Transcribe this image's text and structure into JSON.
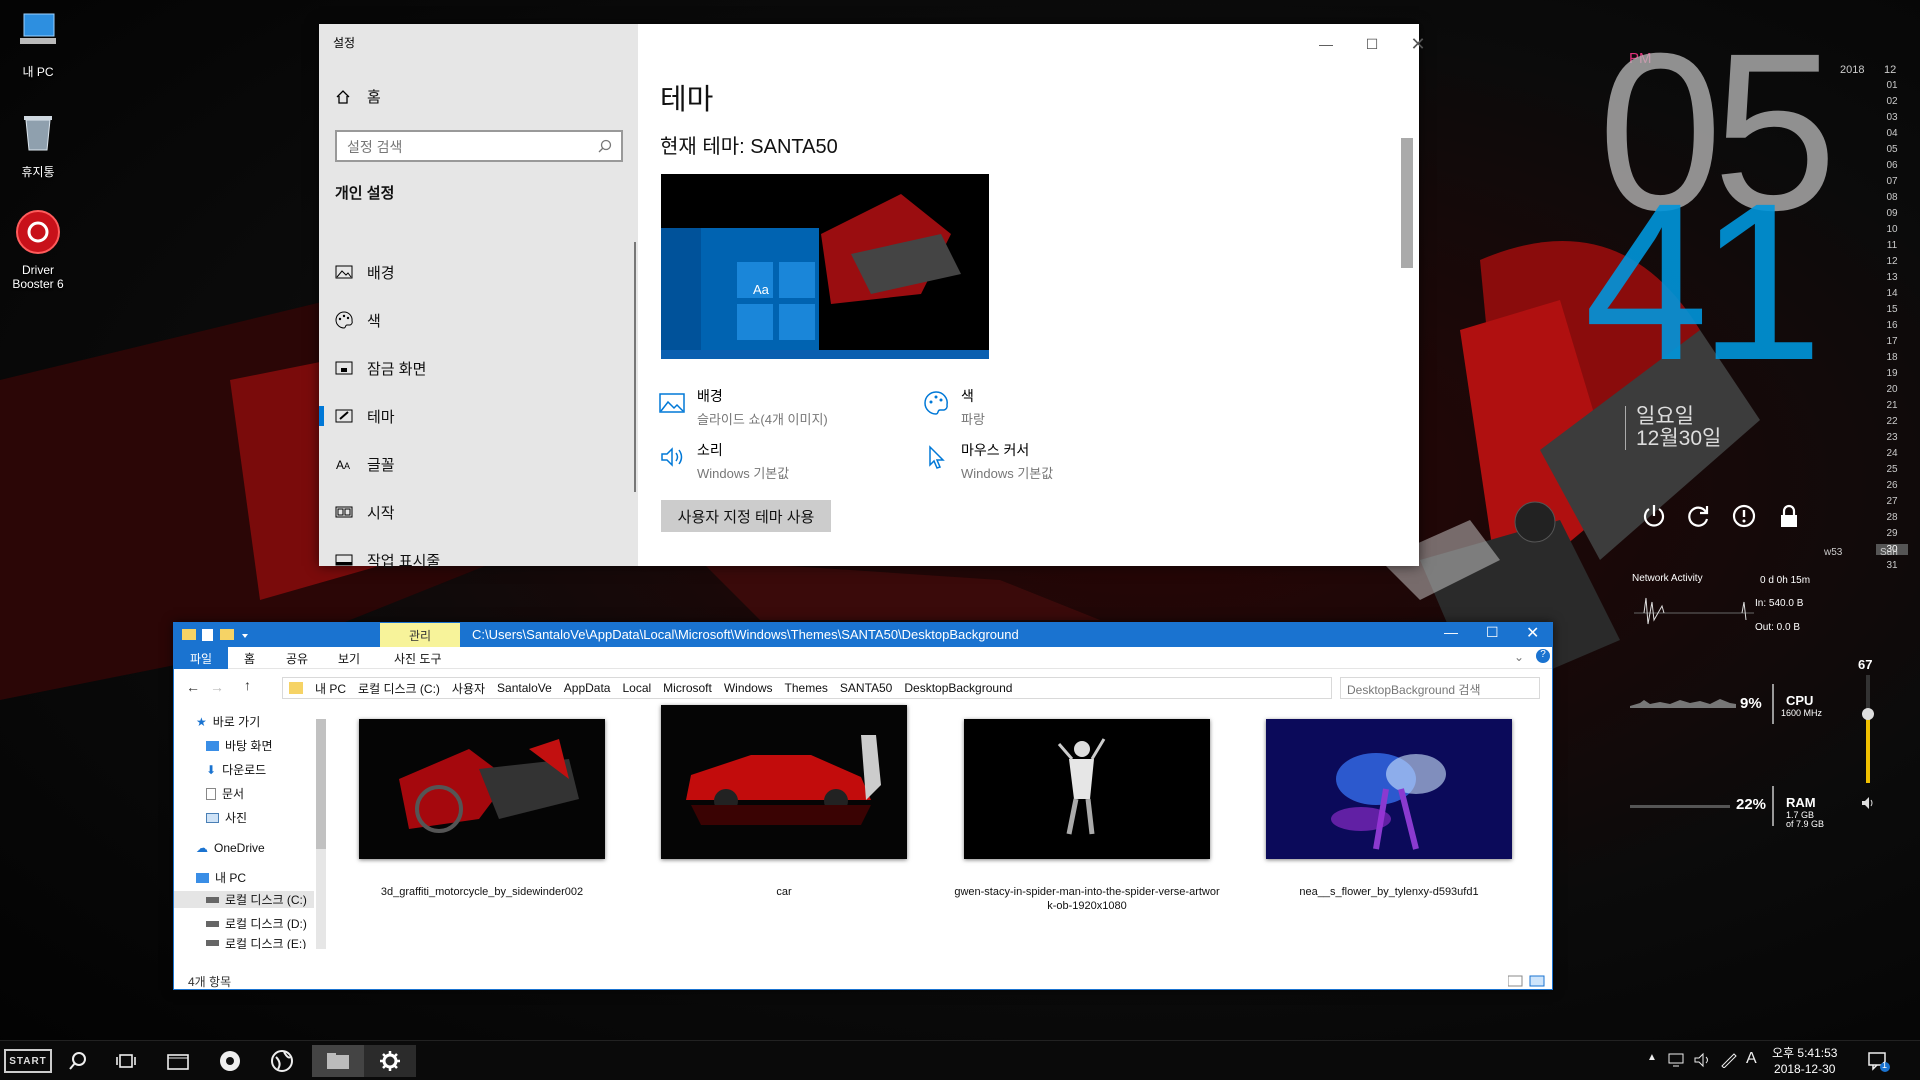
{
  "desktop": {
    "icons": [
      {
        "label": "내 PC",
        "icon": "computer-icon"
      },
      {
        "label": "휴지통",
        "icon": "recycle-bin-icon"
      },
      {
        "label": "Driver Booster 6",
        "icon": "driver-booster-icon"
      }
    ]
  },
  "settings": {
    "title": "설정",
    "home": "홈",
    "search_placeholder": "설정 검색",
    "section": "개인 설정",
    "nav": [
      {
        "label": "배경",
        "icon": "picture-icon"
      },
      {
        "label": "색",
        "icon": "palette-icon"
      },
      {
        "label": "잠금 화면",
        "icon": "lock-screen-icon"
      },
      {
        "label": "테마",
        "icon": "theme-icon",
        "active": true
      },
      {
        "label": "글꼴",
        "icon": "font-icon"
      },
      {
        "label": "시작",
        "icon": "start-icon"
      },
      {
        "label": "작업 표시줄",
        "icon": "taskbar-icon"
      }
    ],
    "heading": "테마",
    "current_theme": "현재 테마: SANTA50",
    "preview_sample": "Aa",
    "items": [
      {
        "title": "배경",
        "sub": "슬라이드 쇼(4개 이미지)",
        "icon": "picture-icon"
      },
      {
        "title": "색",
        "sub": "파랑",
        "icon": "palette-icon"
      },
      {
        "title": "소리",
        "sub": "Windows 기본값",
        "icon": "speaker-icon"
      },
      {
        "title": "마우스 커서",
        "sub": "Windows 기본값",
        "icon": "cursor-icon"
      }
    ],
    "custom_button": "사용자 지정 테마 사용"
  },
  "clock": {
    "ampm": "PM",
    "hour": "05",
    "minute": "41",
    "weekday": "일요일",
    "date": "12월30일"
  },
  "calendar": {
    "year": "2018",
    "month": "12",
    "days": [
      "01",
      "02",
      "03",
      "04",
      "05",
      "06",
      "07",
      "08",
      "09",
      "10",
      "11",
      "12",
      "13",
      "14",
      "15",
      "16",
      "17",
      "18",
      "19",
      "20",
      "21",
      "22",
      "23",
      "24",
      "25",
      "26",
      "27",
      "28",
      "29",
      "30",
      "31"
    ],
    "week": "w53",
    "current_day": "30",
    "current_weekday": "Sun"
  },
  "system": {
    "network_label": "Network Activity",
    "uptime": "0 d 0h 15m",
    "net_in": "In: 540.0 B",
    "net_out": "Out: 0.0 B",
    "cpu_pct": "9%",
    "cpu_label": "CPU",
    "cpu_freq": "1600 MHz",
    "ram_pct": "22%",
    "ram_label": "RAM",
    "ram_used": "1.7 GB",
    "ram_total": "of 7.9 GB",
    "volume": "67",
    "volume_level": 0.67
  },
  "explorer": {
    "tab_manage": "관리",
    "title_path": "C:\\Users\\SantaloVe\\AppData\\Local\\Microsoft\\Windows\\Themes\\SANTA50\\DesktopBackground",
    "ribbon": [
      "파일",
      "홈",
      "공유",
      "보기",
      "사진 도구"
    ],
    "breadcrumb": [
      "내 PC",
      "로컬 디스크 (C:)",
      "사용자",
      "SantaloVe",
      "AppData",
      "Local",
      "Microsoft",
      "Windows",
      "Themes",
      "SANTA50",
      "DesktopBackground"
    ],
    "search_placeholder": "DesktopBackground 검색",
    "tree": [
      {
        "label": "바로 가기",
        "icon": "star-icon"
      },
      {
        "label": "바탕 화면",
        "icon": "desktop-icon"
      },
      {
        "label": "다운로드",
        "icon": "download-icon"
      },
      {
        "label": "문서",
        "icon": "document-icon"
      },
      {
        "label": "사진",
        "icon": "pictures-icon"
      },
      {
        "label": "OneDrive",
        "icon": "cloud-icon"
      },
      {
        "label": "내 PC",
        "icon": "computer-icon"
      },
      {
        "label": "로컬 디스크 (C:)",
        "icon": "drive-icon"
      },
      {
        "label": "로컬 디스크 (D:)",
        "icon": "drive-icon"
      },
      {
        "label": "로컬 디스크 (E:)",
        "icon": "drive-icon"
      }
    ],
    "files": [
      {
        "name": "3d_graffiti_motorcycle_by_sidewinder002"
      },
      {
        "name": "car"
      },
      {
        "name": "gwen-stacy-in-spider-man-into-the-spider-verse-artwork-ob-1920x1080"
      },
      {
        "name": "nea__s_flower_by_tylenxy-d593ufd1"
      }
    ],
    "status": "4개 항목"
  },
  "taskbar": {
    "start": "START",
    "ime": "A",
    "time": "오후 5:41:53",
    "date": "2018-12-30",
    "notification_count": "1"
  },
  "colors": {
    "accent": "#1a73d0",
    "settings_accent": "#0078d7",
    "clock_blue": "#0096dc",
    "pm": "#e0307a"
  }
}
